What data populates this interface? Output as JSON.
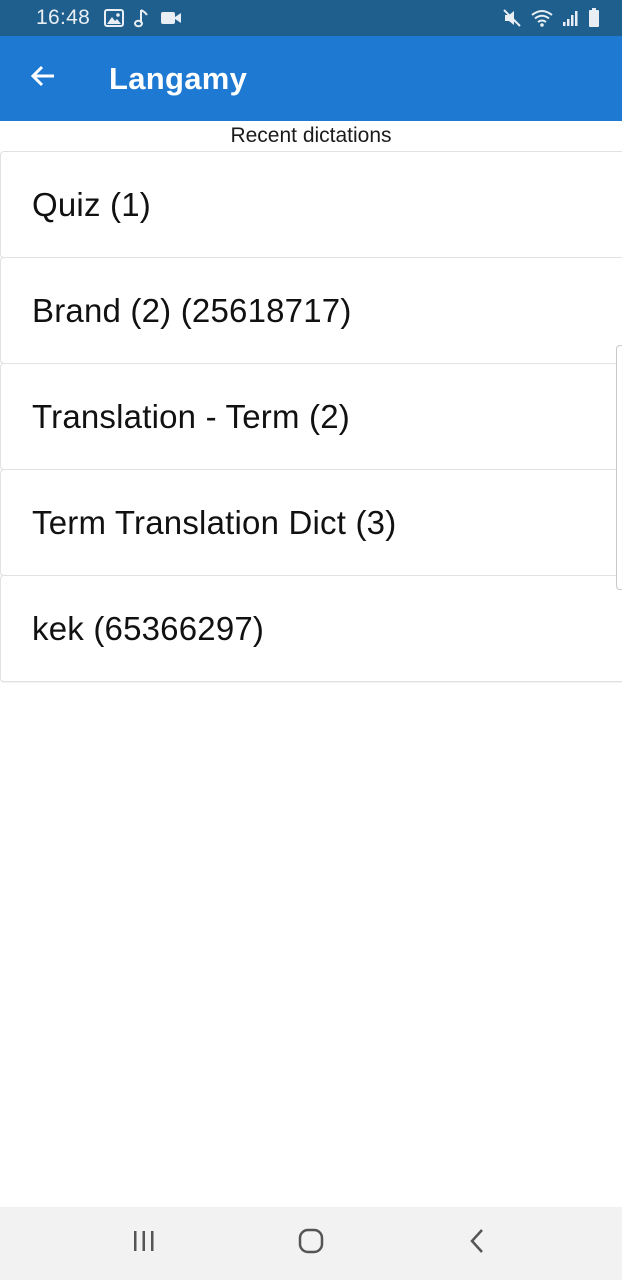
{
  "status_bar": {
    "time": "16:48",
    "left_icons": [
      "image-icon",
      "music-note-icon",
      "video-camera-icon"
    ],
    "right_icons": [
      "mute-icon",
      "wifi-icon",
      "signal-icon",
      "battery-icon"
    ]
  },
  "app_bar": {
    "title": "Langamy",
    "back_icon": "arrow-left-icon",
    "color": "#1e79d3"
  },
  "section_title": "Recent dictations",
  "dictations": [
    {
      "label": "Quiz (1)"
    },
    {
      "label": "Brand (2) (25618717)"
    },
    {
      "label": "Translation - Term (2)"
    },
    {
      "label": "Term Translation Dict (3)"
    },
    {
      "label": "kek (65366297)"
    }
  ],
  "nav_bar": {
    "buttons": [
      "recent-apps-icon",
      "home-icon",
      "back-icon"
    ]
  },
  "colors": {
    "status_bar": "#1f5f8d",
    "app_bar": "#1e79d3",
    "nav_bar": "#f2f2f2"
  }
}
